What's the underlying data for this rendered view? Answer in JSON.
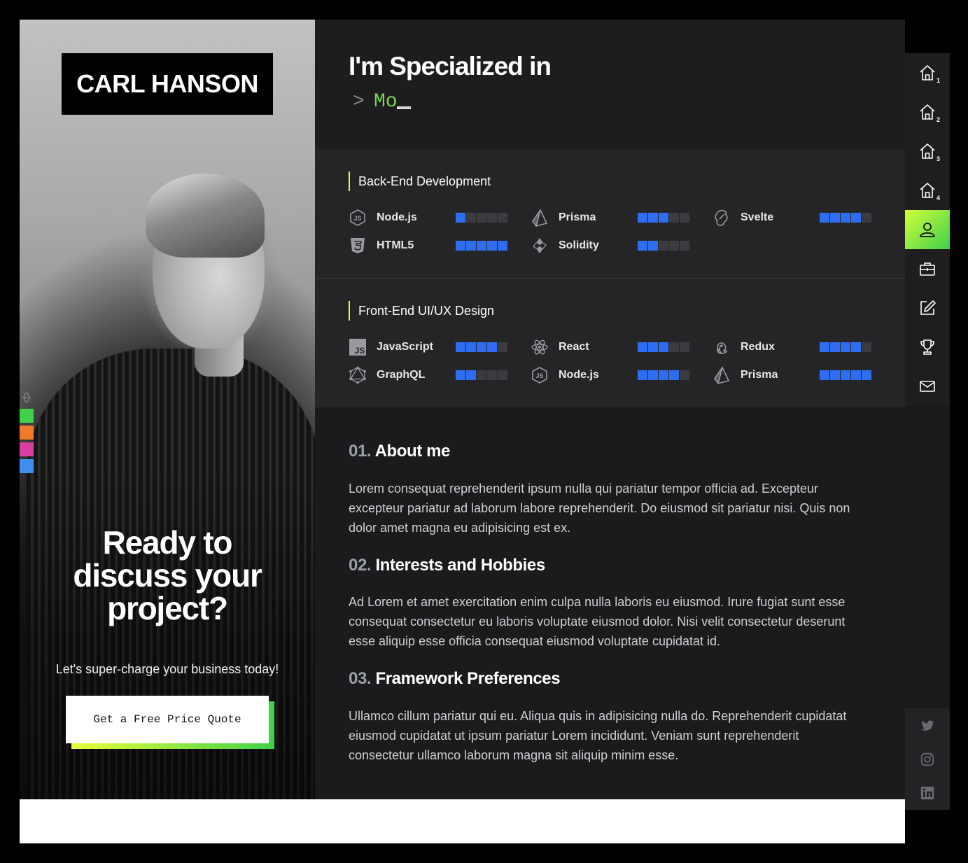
{
  "hero": {
    "logo": "CARL HANSON",
    "cta_title_line1": "Ready to",
    "cta_title_line2": "discuss your",
    "cta_title_line3": "project?",
    "cta_subtitle": "Let's super-charge your business today!",
    "quote_button": "Get a Free Price Quote",
    "swatches": [
      "#3fd14a",
      "#f07a28",
      "#d83fa0",
      "#3f8ff0"
    ]
  },
  "specialized": {
    "title": "I'm Specialized in",
    "prompt": ">",
    "typed": "Mo"
  },
  "backend": {
    "heading": "Back-End Development",
    "skills": [
      {
        "name": "Node.js",
        "icon": "nodejs-icon",
        "level": 1
      },
      {
        "name": "Prisma",
        "icon": "prisma-icon",
        "level": 3
      },
      {
        "name": "Svelte",
        "icon": "svelte-icon",
        "level": 4
      },
      {
        "name": "HTML5",
        "icon": "html5-icon",
        "level": 5
      },
      {
        "name": "Solidity",
        "icon": "solidity-icon",
        "level": 2
      }
    ]
  },
  "frontend": {
    "heading": "Front-End UI/UX Design",
    "skills": [
      {
        "name": "JavaScript",
        "icon": "javascript-icon",
        "level": 4
      },
      {
        "name": "React",
        "icon": "react-icon",
        "level": 3
      },
      {
        "name": "Redux",
        "icon": "redux-icon",
        "level": 4
      },
      {
        "name": "GraphQL",
        "icon": "graphql-icon",
        "level": 2
      },
      {
        "name": "Node.js",
        "icon": "nodejs-icon",
        "level": 4
      },
      {
        "name": "Prisma",
        "icon": "prisma-icon",
        "level": 5
      }
    ],
    "js_badge": "JS"
  },
  "about": [
    {
      "num": "01.",
      "title": "About me",
      "text": "Lorem consequat reprehenderit ipsum nulla qui pariatur tempor officia ad. Excepteur excepteur pariatur ad laborum labore reprehenderit. Do eiusmod sit pariatur nisi. Quis non dolor amet magna eu adipisicing est ex."
    },
    {
      "num": "02.",
      "title": "Interests and Hobbies",
      "text": "Ad Lorem et amet exercitation enim culpa nulla laboris eu eiusmod. Irure fugiat sunt esse consequat consectetur eu laboris voluptate eiusmod dolor. Nisi velit consectetur deserunt esse aliquip esse officia consequat eiusmod voluptate cupidatat id."
    },
    {
      "num": "03.",
      "title": "Framework Preferences",
      "text": "Ullamco cillum pariatur qui eu. Aliqua quis in adipisicing nulla do. Reprehenderit cupidatat eiusmod cupidatat ut ipsum pariatur Lorem incididunt. Veniam sunt reprehenderit consectetur ullamco laborum magna sit aliquip minim esse."
    }
  ],
  "nav": {
    "items": [
      {
        "icon": "home-icon",
        "sub": "1"
      },
      {
        "icon": "home-icon",
        "sub": "2"
      },
      {
        "icon": "home-icon",
        "sub": "3"
      },
      {
        "icon": "home-icon",
        "sub": "4"
      },
      {
        "icon": "user-icon",
        "sub": "",
        "active": true
      },
      {
        "icon": "briefcase-icon",
        "sub": ""
      },
      {
        "icon": "edit-icon",
        "sub": ""
      },
      {
        "icon": "trophy-icon",
        "sub": ""
      },
      {
        "icon": "mail-icon",
        "sub": ""
      }
    ],
    "social": [
      "twitter-icon",
      "instagram-icon",
      "linkedin-icon"
    ]
  },
  "colors": {
    "accent_green": "#3fd14a",
    "accent_lime": "#d3ff3b",
    "skill_bar": "#2f6df0",
    "panel": "#252528",
    "background": "#1b1b1e"
  }
}
